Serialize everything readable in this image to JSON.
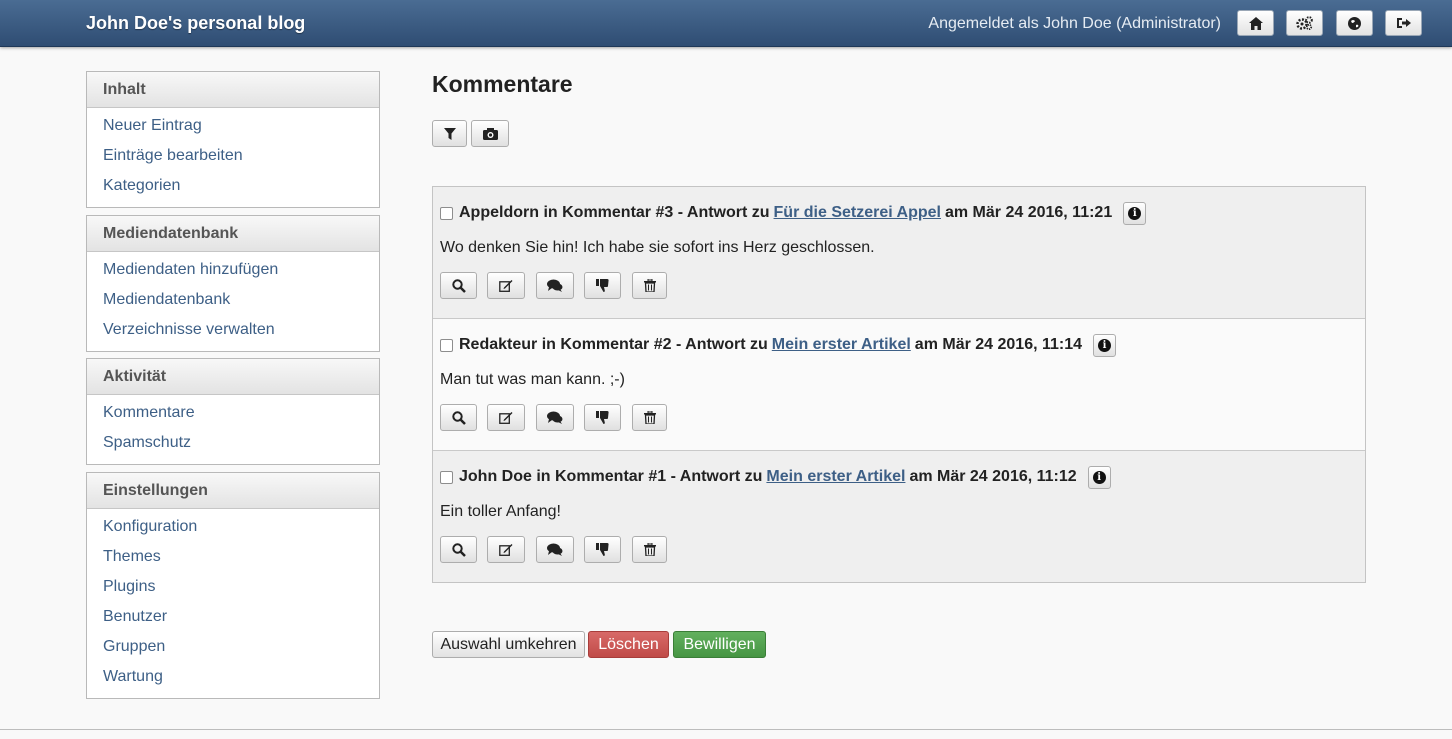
{
  "header": {
    "blog_title": "John Doe's personal blog",
    "logged_in_text": "Angemeldet als John Doe (Administrator)",
    "buttons": [
      {
        "icon": "home-icon",
        "glyph": "⌂"
      },
      {
        "icon": "gears-icon",
        "glyph": "⚙"
      },
      {
        "icon": "globe-icon",
        "glyph": "🌐"
      },
      {
        "icon": "sign-out-icon",
        "glyph": "➜"
      }
    ]
  },
  "sidebar": {
    "panels": [
      {
        "title": "Inhalt",
        "items": [
          "Neuer Eintrag",
          "Einträge bearbeiten",
          "Kategorien"
        ]
      },
      {
        "title": "Mediendatenbank",
        "items": [
          "Mediendaten hinzufügen",
          "Mediendatenbank",
          "Verzeichnisse verwalten"
        ]
      },
      {
        "title": "Aktivität",
        "items": [
          "Kommentare",
          "Spamschutz"
        ]
      },
      {
        "title": "Einstellungen",
        "items": [
          "Konfiguration",
          "Themes",
          "Plugins",
          "Benutzer",
          "Gruppen",
          "Wartung"
        ]
      }
    ]
  },
  "main": {
    "title": "Kommentare",
    "toolbar": {
      "filter_icon": "filter-icon",
      "camera_icon": "camera-icon"
    },
    "comments": [
      {
        "author": "Appeldorn",
        "prefix": " in Kommentar #3 - Antwort zu",
        "link": "Für die Setzerei Appel",
        "date": "am Mär 24 2016, 11:21",
        "text": "Wo denken Sie hin! Ich habe sie sofort ins Herz geschlossen."
      },
      {
        "author": "Redakteur",
        "prefix": " in Kommentar #2 - Antwort zu",
        "link": "Mein erster Artikel",
        "date": "am Mär 24 2016, 11:14",
        "text": "Man tut was man kann. ;-)"
      },
      {
        "author": "John Doe",
        "prefix": " in Kommentar #1 - Antwort zu",
        "link": "Mein erster Artikel",
        "date": "am Mär 24 2016, 11:12",
        "text": "Ein toller Anfang!"
      }
    ],
    "actions": {
      "invert_label": "Auswahl umkehren",
      "delete_label": "Löschen",
      "approve_label": "Bewilligen"
    }
  },
  "colors": {
    "header_top": "#4a6c93",
    "header_bottom": "#2f4d73",
    "link": "#3d5f86",
    "danger": "#c9534f",
    "success": "#529f4e"
  }
}
